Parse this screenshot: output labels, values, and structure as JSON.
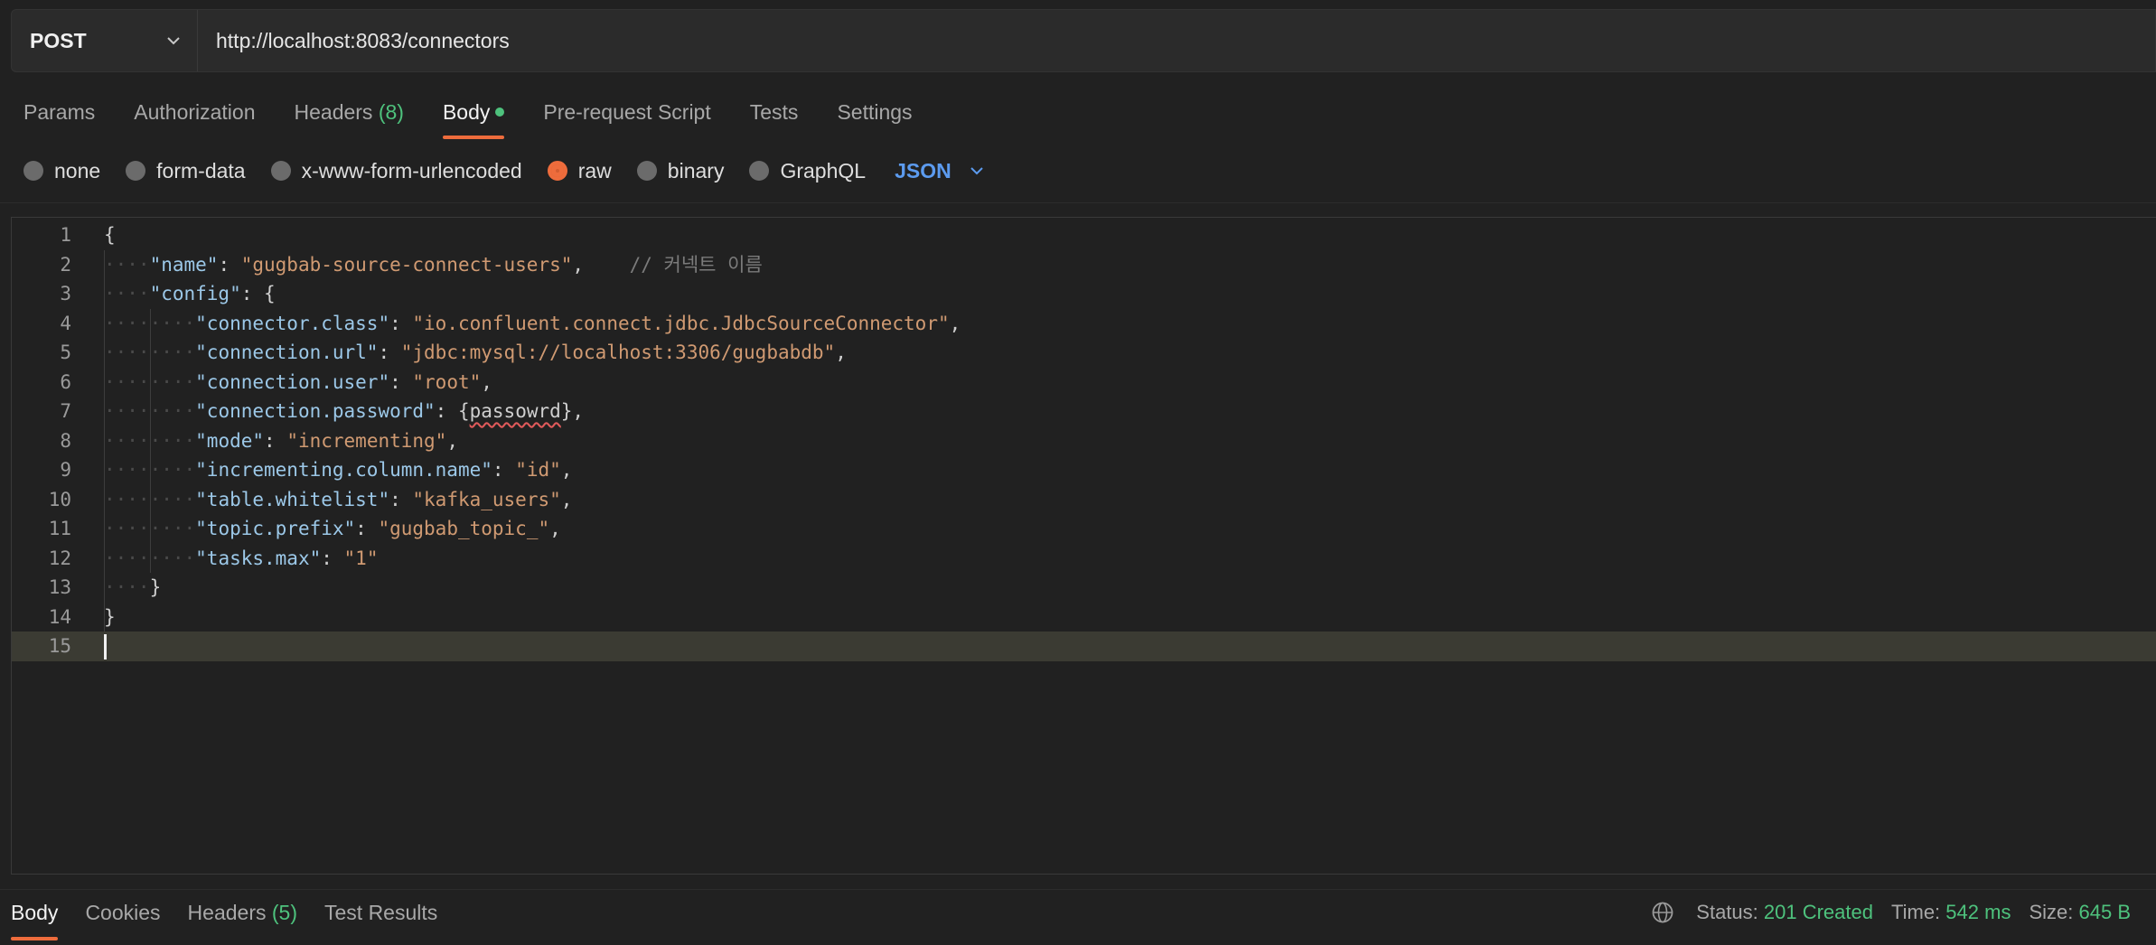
{
  "request": {
    "method": "POST",
    "url": "http://localhost:8083/connectors"
  },
  "tabs": [
    {
      "label": "Params"
    },
    {
      "label": "Authorization"
    },
    {
      "label": "Headers",
      "count": "(8)"
    },
    {
      "label": "Body"
    },
    {
      "label": "Pre-request Script"
    },
    {
      "label": "Tests"
    },
    {
      "label": "Settings"
    }
  ],
  "body_options": {
    "items": [
      "none",
      "form-data",
      "x-www-form-urlencoded",
      "raw",
      "binary",
      "GraphQL"
    ],
    "selected": "raw",
    "format": "JSON"
  },
  "editor": {
    "line_numbers": [
      "1",
      "2",
      "3",
      "4",
      "5",
      "6",
      "7",
      "8",
      "9",
      "10",
      "11",
      "12",
      "13",
      "14",
      "15"
    ],
    "lines": [
      {
        "tokens": [
          {
            "t": "p",
            "v": "{"
          }
        ]
      },
      {
        "indent": 1,
        "tokens": [
          {
            "t": "k",
            "v": "\"name\""
          },
          {
            "t": "p",
            "v": ": "
          },
          {
            "t": "s",
            "v": "\"gugbab-source-connect-users\""
          },
          {
            "t": "p",
            "v": ",    "
          },
          {
            "t": "c",
            "v": "// 커넥트 이름"
          }
        ]
      },
      {
        "indent": 1,
        "tokens": [
          {
            "t": "k",
            "v": "\"config\""
          },
          {
            "t": "p",
            "v": ": {"
          }
        ]
      },
      {
        "indent": 2,
        "tokens": [
          {
            "t": "k",
            "v": "\"connector.class\""
          },
          {
            "t": "p",
            "v": ": "
          },
          {
            "t": "s",
            "v": "\"io.confluent.connect.jdbc.JdbcSourceConnector\""
          },
          {
            "t": "p",
            "v": ","
          }
        ]
      },
      {
        "indent": 2,
        "tokens": [
          {
            "t": "k",
            "v": "\"connection.url\""
          },
          {
            "t": "p",
            "v": ": "
          },
          {
            "t": "s",
            "v": "\"jdbc:mysql://localhost:3306/gugbabdb\""
          },
          {
            "t": "p",
            "v": ","
          }
        ]
      },
      {
        "indent": 2,
        "tokens": [
          {
            "t": "k",
            "v": "\"connection.user\""
          },
          {
            "t": "p",
            "v": ": "
          },
          {
            "t": "s",
            "v": "\"root\""
          },
          {
            "t": "p",
            "v": ","
          }
        ]
      },
      {
        "indent": 2,
        "tokens": [
          {
            "t": "k",
            "v": "\"connection.password\""
          },
          {
            "t": "p",
            "v": ": "
          },
          {
            "t": "p",
            "v": "{"
          },
          {
            "t": "err",
            "v": "passowrd"
          },
          {
            "t": "p",
            "v": "},"
          }
        ]
      },
      {
        "indent": 2,
        "tokens": [
          {
            "t": "k",
            "v": "\"mode\""
          },
          {
            "t": "p",
            "v": ": "
          },
          {
            "t": "s",
            "v": "\"incrementing\""
          },
          {
            "t": "p",
            "v": ","
          }
        ]
      },
      {
        "indent": 2,
        "tokens": [
          {
            "t": "k",
            "v": "\"incrementing.column.name\""
          },
          {
            "t": "p",
            "v": ": "
          },
          {
            "t": "s",
            "v": "\"id\""
          },
          {
            "t": "p",
            "v": ","
          }
        ]
      },
      {
        "indent": 2,
        "tokens": [
          {
            "t": "k",
            "v": "\"table.whitelist\""
          },
          {
            "t": "p",
            "v": ": "
          },
          {
            "t": "s",
            "v": "\"kafka_users\""
          },
          {
            "t": "p",
            "v": ","
          }
        ]
      },
      {
        "indent": 2,
        "tokens": [
          {
            "t": "k",
            "v": "\"topic.prefix\""
          },
          {
            "t": "p",
            "v": ": "
          },
          {
            "t": "s",
            "v": "\"gugbab_topic_\""
          },
          {
            "t": "p",
            "v": ","
          }
        ]
      },
      {
        "indent": 2,
        "tokens": [
          {
            "t": "k",
            "v": "\"tasks.max\""
          },
          {
            "t": "p",
            "v": ": "
          },
          {
            "t": "s",
            "v": "\"1\""
          }
        ]
      },
      {
        "indent": 1,
        "tokens": [
          {
            "t": "p",
            "v": "}"
          }
        ]
      },
      {
        "tokens": [
          {
            "t": "p",
            "v": "}"
          }
        ]
      },
      {
        "tokens": [],
        "current": true
      }
    ]
  },
  "response": {
    "tabs": [
      {
        "label": "Body"
      },
      {
        "label": "Cookies"
      },
      {
        "label": "Headers",
        "count": "(5)"
      },
      {
        "label": "Test Results"
      }
    ],
    "status_label": "Status:",
    "status_value": "201 Created",
    "time_label": "Time:",
    "time_value": "542 ms",
    "size_label": "Size:",
    "size_value": "645 B"
  },
  "colors": {
    "accent": "#ee6c3c",
    "success": "#4ec27d",
    "link": "#5c9bef"
  }
}
